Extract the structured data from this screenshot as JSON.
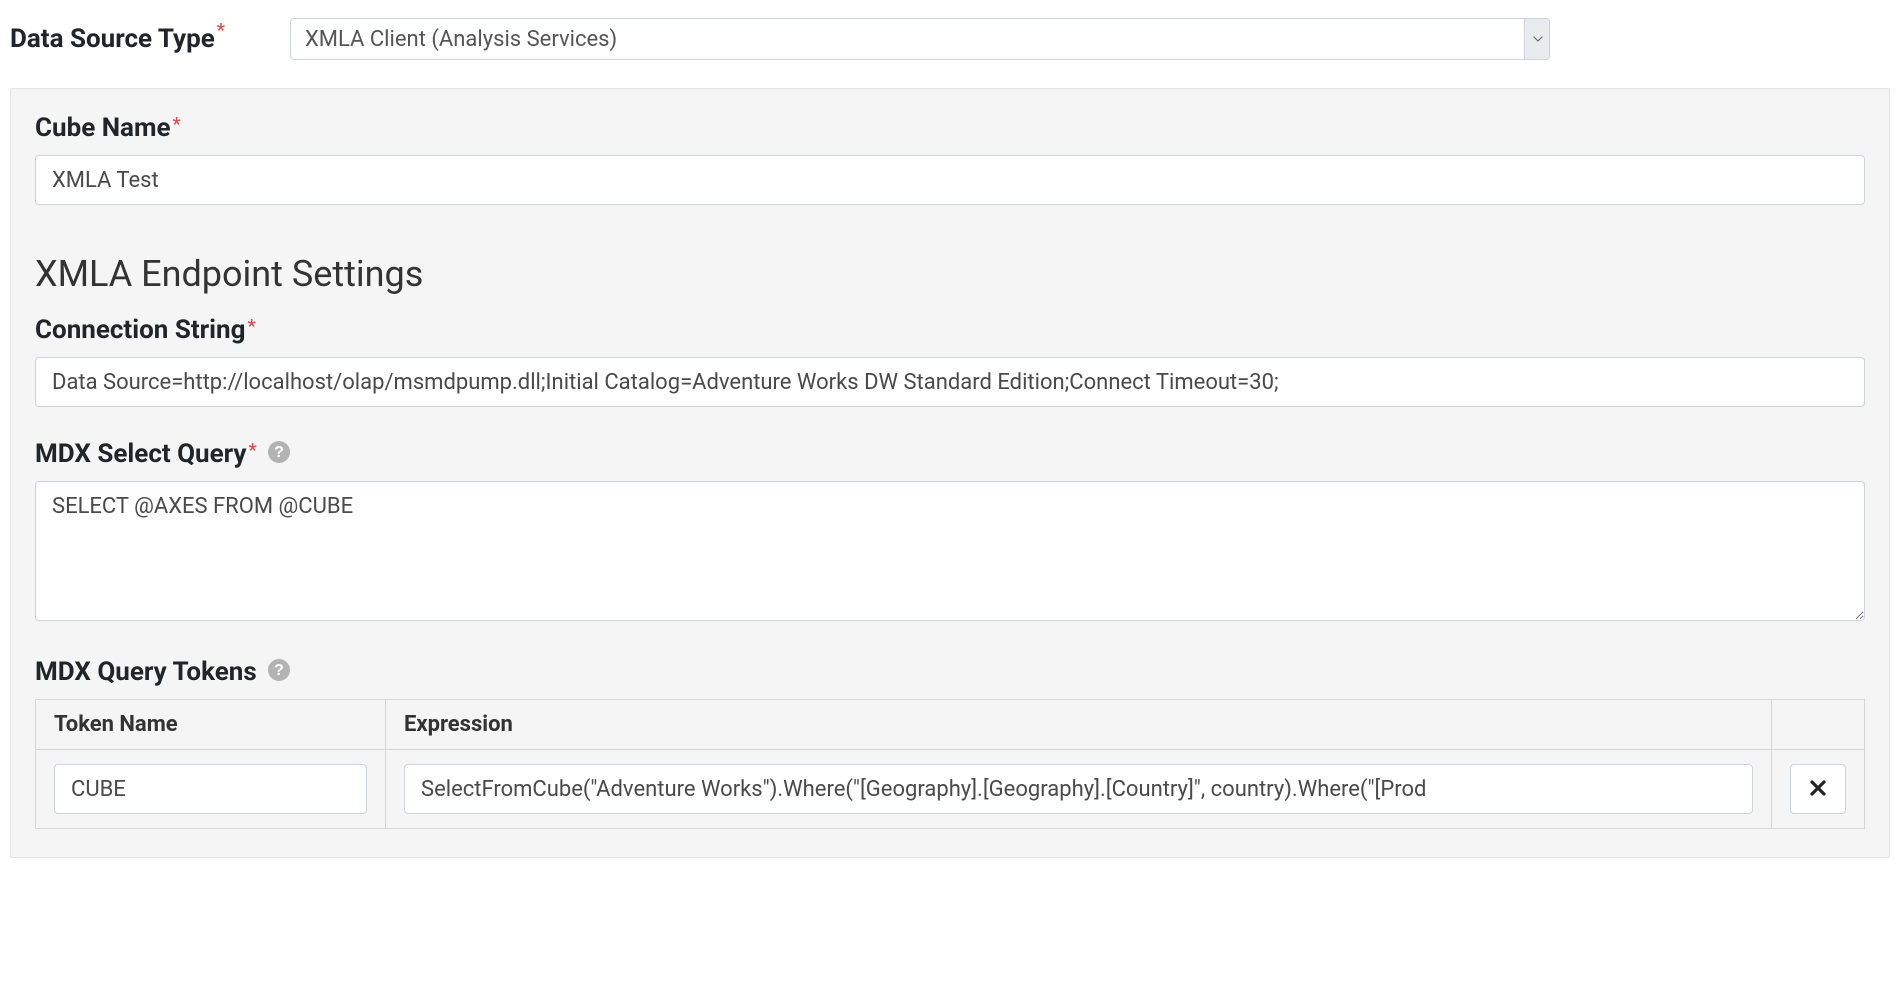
{
  "dataSource": {
    "label": "Data Source Type",
    "selected": "XMLA Client (Analysis Services)"
  },
  "panel": {
    "cubeName": {
      "label": "Cube Name",
      "value": "XMLA Test"
    },
    "sectionHeading": "XMLA Endpoint Settings",
    "connectionString": {
      "label": "Connection String",
      "value": "Data Source=http://localhost/olap/msmdpump.dll;Initial Catalog=Adventure Works DW Standard Edition;Connect Timeout=30;"
    },
    "mdxSelectQuery": {
      "label": "MDX Select Query",
      "value": "SELECT @AXES FROM @CUBE"
    },
    "mdxQueryTokens": {
      "label": "MDX Query Tokens",
      "headers": {
        "name": "Token Name",
        "expr": "Expression",
        "action": ""
      },
      "rows": [
        {
          "name": "CUBE",
          "expr": "SelectFromCube(\"Adventure Works\").Where(\"[Geography].[Geography].[Country]\", country).Where(\"[Prod"
        }
      ]
    }
  }
}
